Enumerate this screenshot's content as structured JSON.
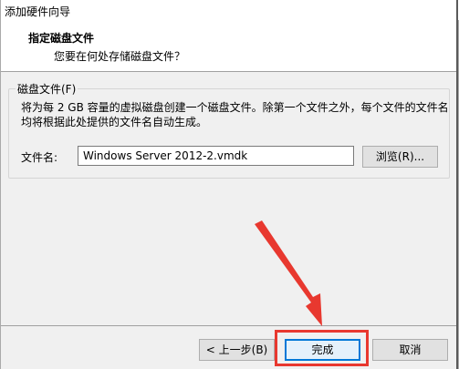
{
  "window": {
    "title": "添加硬件向导"
  },
  "header": {
    "heading": "指定磁盘文件",
    "subheading": "您要在何处存储磁盘文件？"
  },
  "disk_file_group": {
    "legend": "磁盘文件(F)",
    "description": "将为每 2 GB 容量的虚拟磁盘创建一个磁盘文件。除第一个文件之外，每个文件的文件名均将根据此处提供的文件名自动生成。",
    "filename_label": "文件名:",
    "filename_value": "Windows Server 2012-2.vmdk",
    "browse_label": "浏览(R)..."
  },
  "footer": {
    "back_label": "< 上一步(B)",
    "finish_label": "完成",
    "cancel_label": "取消"
  },
  "annotation": {
    "color": "#e8382f",
    "arrow_icon": "red-arrow-icon"
  }
}
